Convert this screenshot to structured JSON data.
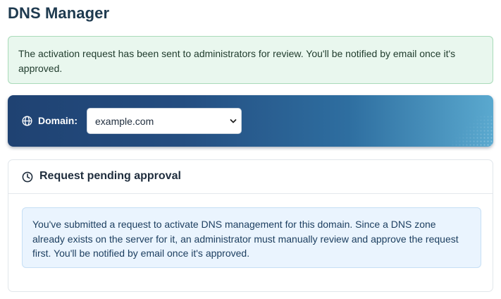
{
  "page": {
    "title": "DNS Manager"
  },
  "success_alert": {
    "message": "The activation request has been sent to administrators for review. You'll be notified by email once it's approved."
  },
  "domain_bar": {
    "icon": "globe-icon",
    "label": "Domain:",
    "selected_domain": "example.com"
  },
  "pending_card": {
    "icon": "clock-icon",
    "title": "Request pending approval",
    "info_message": "You've submitted a request to activate DNS management for this domain. Since a DNS zone already exists on the server for it, an administrator must manually review and approve the request first. You'll be notified by email once it's approved."
  },
  "colors": {
    "success_bg": "#e9f7ee",
    "info_bg": "#eaf4fe",
    "bar_gradient_start": "#1f4272",
    "bar_gradient_end": "#5aa9cf"
  }
}
